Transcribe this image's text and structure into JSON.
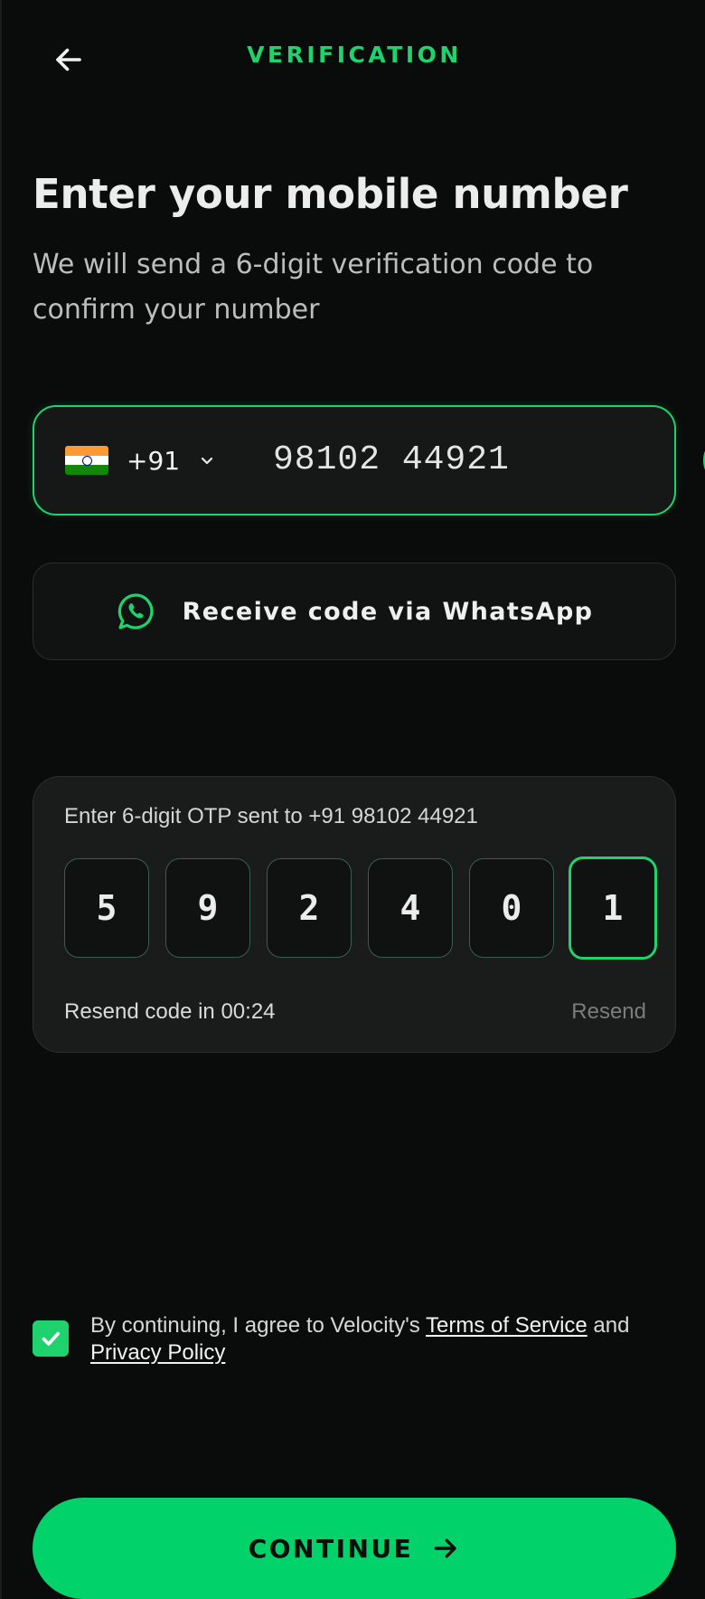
{
  "header": {
    "title": "VERIFICATION",
    "back_icon": "arrow-left-icon"
  },
  "main": {
    "headline": "Enter your mobile number",
    "subtext": "We will send a 6-digit verification code to confirm your number"
  },
  "phone": {
    "country_flag": "india-flag-icon",
    "dial_code": "+91",
    "dropdown_icon": "chevron-down-icon",
    "number": "98102 44921"
  },
  "whatsapp": {
    "icon": "whatsapp-icon",
    "label": "Receive code via WhatsApp"
  },
  "otp": {
    "prompt": "Enter 6-digit OTP sent to +91 98102 44921",
    "digits": [
      "5",
      "9",
      "2",
      "4",
      "0",
      "1"
    ],
    "active_index": 5,
    "resend_timer": "Resend code in 00:24",
    "resend_label": "Resend"
  },
  "consent": {
    "checked": true,
    "prefix": "By continuing, I agree to Velocity's ",
    "terms_label": "Terms of Service",
    "conjunction": " and ",
    "privacy_label": "Privacy Policy"
  },
  "actions": {
    "continue_label": "CONTINUE",
    "continue_icon": "arrow-right-icon"
  },
  "colors": {
    "accent": "#1ed36e",
    "button": "#02d26a",
    "background": "#0a0b0b",
    "card": "#1a1b1b"
  }
}
